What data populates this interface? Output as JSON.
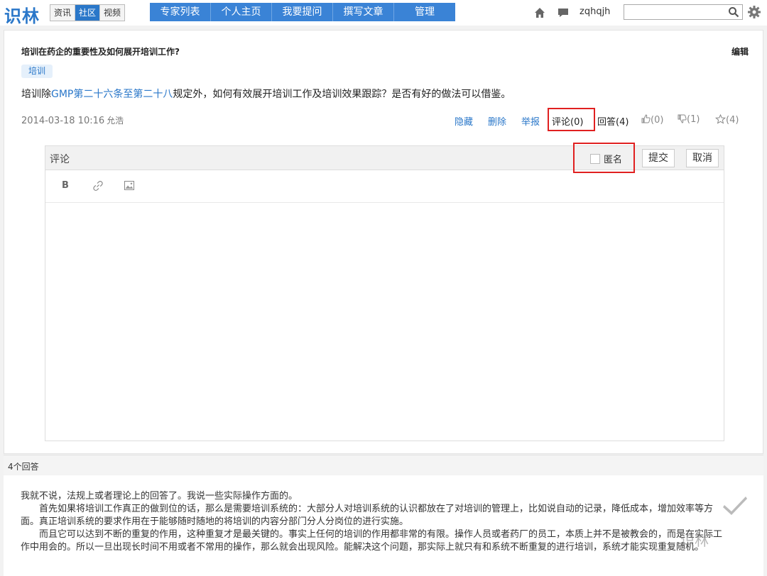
{
  "app": {
    "logo": "识林",
    "segments": [
      "资讯",
      "社区",
      "视频"
    ],
    "active_segment": "社区",
    "nav": [
      "专家列表",
      "个人主页",
      "我要提问",
      "撰写文章",
      "管理"
    ],
    "username": "zqhqjh",
    "search_placeholder": ""
  },
  "question": {
    "title": "培训在药企的重要性及如何展开培训工作?",
    "edit_label": "编辑",
    "tag": "培训",
    "body_prefix": "培训除",
    "body_link": "GMP第二十六条至第二十八",
    "body_suffix": "规定外，如何有效展开培训工作及培训效果跟踪？是否有好的做法可以借鉴。",
    "date": "2014-03-18 10:16",
    "author": "允浩",
    "actions": {
      "hide": "隐藏",
      "delete": "删除",
      "report": "举报",
      "comment": "评论(0)",
      "answer": "回答(4)",
      "like": "(0)",
      "dislike": "(1)",
      "star": "(4)"
    }
  },
  "comment_editor": {
    "label": "评论",
    "anonymous_label": "匿名",
    "submit_label": "提交",
    "cancel_label": "取消",
    "toolbar": [
      "B"
    ]
  },
  "answers": {
    "count_label": "4个回答",
    "first_answer_lines": [
      "我就不说，法规上或者理论上的回答了。我说一些实际操作方面的。",
      "首先如果将培训工作真正的做到位的话，那么是需要培训系统的：大部分人对培训系统的认识都放在了对培训的管理上，比如说自动的记录，降低成本，增加效率等方面。真正培训系统的要求作用在于能够随时随地的将培训的内容分部门分人分岗位的进行实施。",
      "而且它可以达到不断的重复的作用，这种重复才是最关键的。事实上任何的培训的作用都非常的有限。操作人员或者药厂的员工，本质上并不是被教会的，而是在实际工作中用会的。所以一旦出现长时间不用或者不常用的操作，那么就会出现风险。能解决这个问题，那实际上就只有和系统不断重复的进行培训，系统才能实现重复随机。"
    ]
  },
  "watermark": "识林"
}
